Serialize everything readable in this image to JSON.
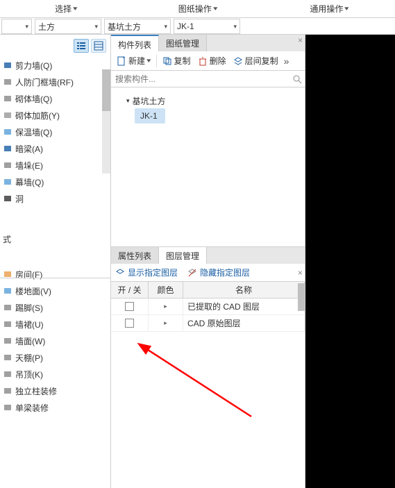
{
  "top_menu": {
    "select": "选择",
    "drawing_ops": "图纸操作",
    "general_ops": "通用操作"
  },
  "dropdowns": {
    "d1": "土方",
    "d2": "基坑土方",
    "d3": "JK-1",
    "blank": ""
  },
  "left_items_top": [
    {
      "label": "剪力墙(Q)",
      "icon": "wall",
      "color": "#1a5fa4"
    },
    {
      "label": "人防门框墙(RF)",
      "icon": "wall",
      "color": "#888"
    },
    {
      "label": "砌体墙(Q)",
      "icon": "wall",
      "color": "#888"
    },
    {
      "label": "砌体加筋(Y)",
      "icon": "rebar",
      "color": "#999"
    },
    {
      "label": "保温墙(Q)",
      "icon": "wall",
      "color": "#5aa0d8"
    },
    {
      "label": "暗梁(A)",
      "icon": "beam",
      "color": "#1a5fa4"
    },
    {
      "label": "墙垛(E)",
      "icon": "wall",
      "color": "#888"
    },
    {
      "label": "幕墙(Q)",
      "icon": "wall",
      "color": "#5aa0d8"
    },
    {
      "label": "洞",
      "icon": "hole",
      "color": "#333"
    }
  ],
  "left_items_bottom": [
    {
      "label": "房间(F)",
      "icon": "room",
      "color": "#e89c4a"
    },
    {
      "label": "楼地面(V)",
      "icon": "floor",
      "color": "#5aa0d8"
    },
    {
      "label": "踢脚(S)",
      "icon": "skirt",
      "color": "#888"
    },
    {
      "label": "墙裙(U)",
      "icon": "wain",
      "color": "#888"
    },
    {
      "label": "墙面(W)",
      "icon": "wallface",
      "color": "#888"
    },
    {
      "label": "天棚(P)",
      "icon": "ceiling",
      "color": "#888"
    },
    {
      "label": "吊顶(K)",
      "icon": "susp",
      "color": "#888"
    },
    {
      "label": "独立柱装修",
      "icon": "col",
      "color": "#888"
    },
    {
      "label": "单梁装修",
      "icon": "beam",
      "color": "#888"
    }
  ],
  "left_label_shi": "式",
  "mid": {
    "tab1": "构件列表",
    "tab2": "图纸管理",
    "btn_new": "新建",
    "btn_copy": "复制",
    "btn_delete": "删除",
    "btn_layercopy": "层间复制",
    "search_placeholder": "搜索构件...",
    "tree_root": "基坑土方",
    "tree_leaf": "JK-1",
    "ptab1": "属性列表",
    "ptab2": "图层管理",
    "show_layer": "显示指定图层",
    "hide_layer": "隐藏指定图层",
    "th1": "开 / 关",
    "th2": "颜色",
    "th3": "名称",
    "rows": [
      {
        "name": "已提取的 CAD 图层"
      },
      {
        "name": "CAD 原始图层"
      }
    ]
  }
}
